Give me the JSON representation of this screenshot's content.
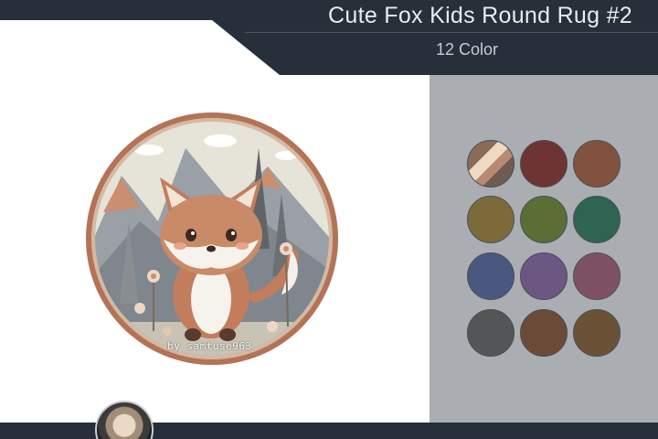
{
  "header": {
    "title": "Cute Fox Kids Round Rug #2",
    "subtitle": "12 Color",
    "band_color": "#262f3a"
  },
  "product": {
    "watermark": "by samtuse963",
    "border_color": "#b47356"
  },
  "palette": {
    "panel_color": "#aaaeb2",
    "swatches": [
      {
        "name": "original",
        "color": "#c79a7e"
      },
      {
        "name": "red",
        "color": "#6e3333"
      },
      {
        "name": "brown",
        "color": "#81533e"
      },
      {
        "name": "mustard",
        "color": "#7d6a3a"
      },
      {
        "name": "green",
        "color": "#5a6e36"
      },
      {
        "name": "teal",
        "color": "#2e6451"
      },
      {
        "name": "blue",
        "color": "#4a5880"
      },
      {
        "name": "purple",
        "color": "#6c5783"
      },
      {
        "name": "rose",
        "color": "#7e5262"
      },
      {
        "name": "grey",
        "color": "#545556"
      },
      {
        "name": "dark-brown",
        "color": "#6b4b37"
      },
      {
        "name": "olive-brown",
        "color": "#6b5236"
      }
    ]
  }
}
